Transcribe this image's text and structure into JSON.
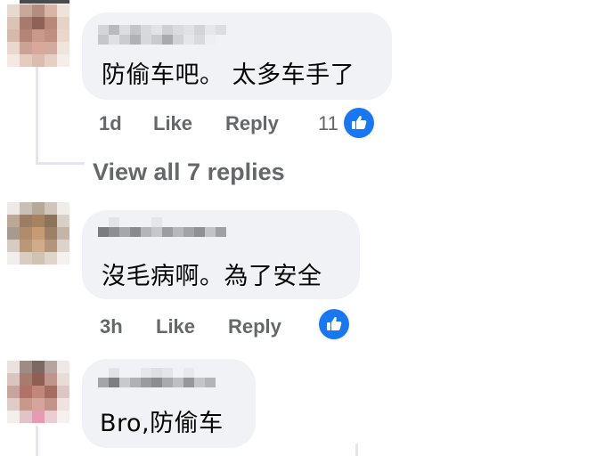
{
  "colors": {
    "bubble_bg": "#f0f2f5",
    "muted_text": "#65676b",
    "like_blue": "#1877f2",
    "text": "#050505"
  },
  "comments": [
    {
      "text": "防偷车吧。 太多车手了",
      "timestamp": "1d",
      "like_label": "Like",
      "reply_label": "Reply",
      "reaction_count": "11",
      "reaction_icon": "thumbs-up-icon"
    },
    {
      "text": "沒毛病啊。為了安全",
      "timestamp": "3h",
      "like_label": "Like",
      "reply_label": "Reply",
      "reaction_icon": "thumbs-up-icon"
    },
    {
      "text": "Bro,防偷车"
    }
  ],
  "view_replies": {
    "label": "View all 7 replies"
  }
}
